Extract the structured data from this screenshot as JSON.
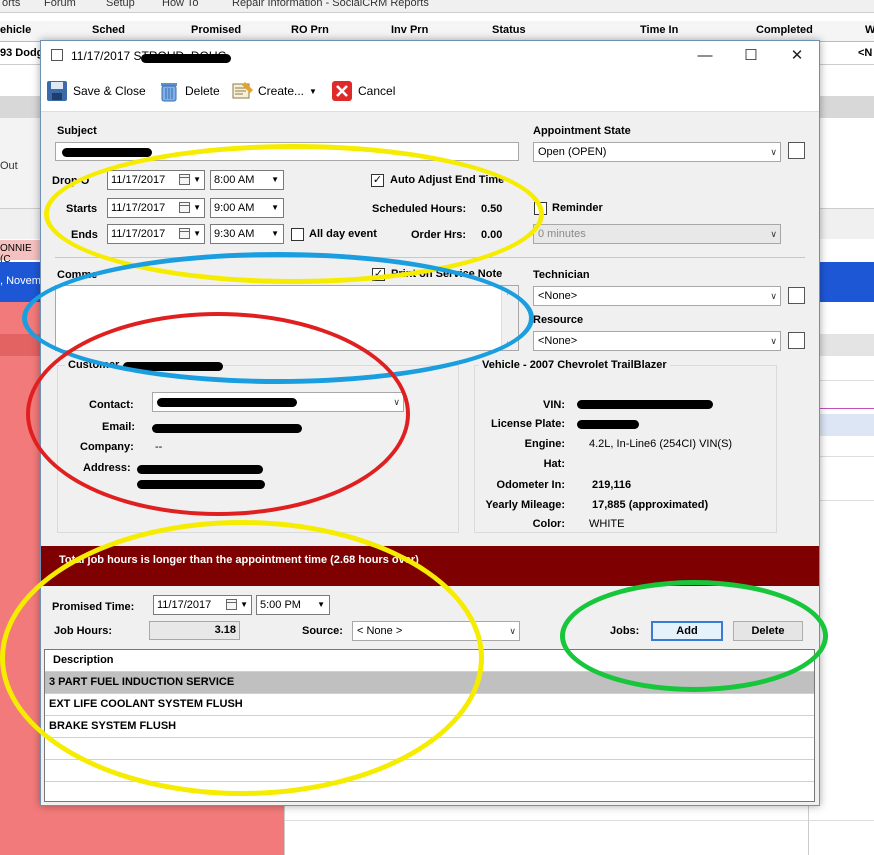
{
  "background": {
    "menu_items": [
      "orts",
      "Forum",
      "Setup",
      "How To",
      "Repair Information - SocialCRM Reports"
    ],
    "columns": [
      "ehicle",
      "Sched",
      "Promised",
      "RO Prn",
      "Inv Prn",
      "Status",
      "Time In",
      "Completed",
      "W"
    ],
    "row1_vehicle": "93 Dodg",
    "row1_last": "<N",
    "out_label": "Out",
    "row_label": "ONNIE (C",
    "blue_row_text": ", Novem"
  },
  "dialog": {
    "title": "11/17/2017 STROUD, DOUG",
    "window_buttons": {
      "minimize": "—",
      "maximize": "☐",
      "close": "✕"
    },
    "toolbar": {
      "save_close": "Save & Close",
      "delete": "Delete",
      "create": "Create...",
      "cancel": "Cancel"
    },
    "subject_label": "Subject",
    "appointment_state_label": "Appointment State",
    "appointment_state_value": "Open (OPEN)",
    "drop_off_label": "Drop O",
    "drop_off_date": "11/17/2017",
    "drop_off_time": "8:00 AM",
    "starts_label": "Starts",
    "starts_date": "11/17/2017",
    "starts_time": "9:00 AM",
    "ends_label": "Ends",
    "ends_date": "11/17/2017",
    "ends_time": "9:30 AM",
    "all_day_label": "All day event",
    "auto_adjust_label": "Auto Adjust End Time",
    "scheduled_hours_label": "Scheduled Hours:",
    "scheduled_hours_value": "0.50",
    "order_hrs_label": "Order Hrs:",
    "order_hrs_value": "0.00",
    "reminder_label": "Reminder",
    "reminder_value": "0 minutes",
    "comments_label": "Comme",
    "print_note_label": "Print on Service Note",
    "technician_label": "Technician",
    "technician_value": "<None>",
    "resource_label": "Resource",
    "resource_value": "<None>",
    "customer": {
      "group_label": "Customer",
      "contact_label": "Contact:",
      "email_label": "Email:",
      "company_label": "Company:",
      "company_value": "--",
      "address_label": "Address:"
    },
    "vehicle": {
      "group_label": "Vehicle - 2007 Chevrolet TrailBlazer",
      "vin_label": "VIN:",
      "plate_label": "License Plate:",
      "engine_label": "Engine:",
      "engine_value": "4.2L, In-Line6 (254CI) VIN(S)",
      "hat_label": "Hat:",
      "odometer_label": "Odometer In:",
      "odometer_value": "219,116",
      "mileage_label": "Yearly Mileage:",
      "mileage_value": "17,885 (approximated)",
      "color_label": "Color:",
      "color_value": "WHITE"
    },
    "warning_text": "Total job hours is longer than the appointment time (2.68 hours over)",
    "promised_time_label": "Promised Time:",
    "promised_date": "11/17/2017",
    "promised_time": "5:00 PM",
    "job_hours_label": "Job Hours:",
    "job_hours_value": "3.18",
    "source_label": "Source:",
    "source_value": "< None >",
    "jobs_label": "Jobs:",
    "add_label": "Add",
    "delete_job_label": "Delete",
    "grid_header": "Description",
    "jobs": [
      "3 PART FUEL INDUCTION SERVICE",
      "EXT LIFE COOLANT SYSTEM FLUSH",
      "BRAKE SYSTEM FLUSH"
    ]
  },
  "annotation_colors": {
    "yellow": "#f5ec00",
    "blue": "#1a9ee0",
    "red": "#e02020",
    "green": "#17c63a"
  }
}
